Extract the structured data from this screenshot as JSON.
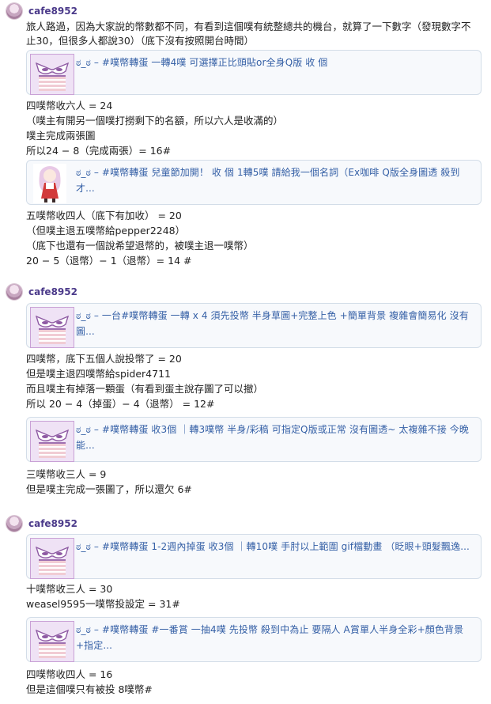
{
  "posts": [
    {
      "author": "cafe8952",
      "intro": "旅人路過，因為大家說的幣數都不同，有看到這個噗有統整總共的機台，就算了一下數字（發現數字不止30，但很多人都說30）（底下沒有按照開台時間）",
      "cards": [
        {
          "icon": "mask-icon",
          "text": "ಠ_ಠ – #噗幣轉蛋 一轉4噗 可選擇正比頭貼or全身Q版 收 個"
        },
        {
          "icon": "chibi-girl-thumbnail",
          "text": "ಠ_ಠ – #噗幣轉蛋 兒童節加開！ 收 個 1轉5噗 請給我一個名詞（Ex咖啡 Q版全身圖透 殺到才..."
        }
      ],
      "lines_a": [
        "四噗幣收六人 = 24",
        "（噗主有開另一個噗打撈剩下的名額，所以六人是收滿的）",
        "噗主完成兩張圖",
        "所以24 − 8（完成兩張）= 16#"
      ],
      "lines_b": [
        "五噗幣收四人（底下有加收） = 20",
        "（但噗主退五噗幣給pepper2248）",
        "（底下也還有一個說希望退幣的，被噗主退一噗幣）",
        "20 − 5（退幣）− 1（退幣）= 14 #"
      ]
    },
    {
      "author": "cafe8952",
      "cards": [
        {
          "icon": "mask-icon",
          "text": "ಠ_ಠ – 一台#噗幣轉蛋 一轉 x 4 須先投幣 半身草圖+完整上色 +簡單背景 複雜會簡易化 沒有圖..."
        },
        {
          "icon": "mask-icon",
          "text": "ಠ_ಠ – #噗幣轉蛋 收3個 ｜轉3噗幣 半身/彩稿 可指定Q版或正常 沒有圖透~ 太複雜不接 今晚能..."
        }
      ],
      "lines_a": [
        "四噗幣，底下五個人說投幣了 = 20",
        "但是噗主退四噗幣給spider4711",
        "而且噗主有掉落一顆蛋（有看到蛋主說存圖了可以撤）",
        "所以 20 − 4（掉蛋）− 4（退幣） = 12#"
      ],
      "lines_b": [
        "三噗幣收三人 = 9",
        "但是噗主完成一張圖了，所以還欠 6#"
      ]
    },
    {
      "author": "cafe8952",
      "cards": [
        {
          "icon": "mask-icon",
          "text": "ಠ_ಠ – #噗幣轉蛋 1-2週內掉蛋 收3個 ｜轉10噗 手肘以上範圍 gif檔動畫 （眨眼+頭髮飄逸..."
        },
        {
          "icon": "mask-icon",
          "text": "ಠ_ಠ – #噗幣轉蛋 #一番賞 一抽4噗 先投幣 殺到中為止 要隔人 A賞單人半身全彩+顏色背景+指定..."
        }
      ],
      "lines_a": [
        "十噗幣收三人 = 30",
        "weasel9595一噗幣投設定 = 31#"
      ],
      "lines_b": [
        "四噗幣收四人 = 16",
        "但是這個噗只有被投 8噗幣#"
      ]
    }
  ]
}
